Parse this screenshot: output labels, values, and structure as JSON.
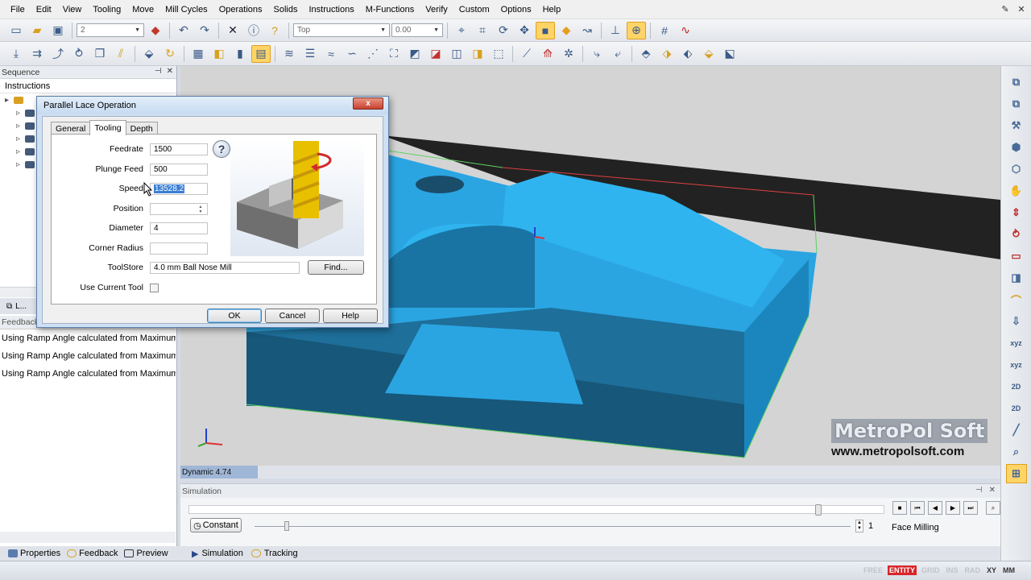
{
  "menu": [
    "File",
    "Edit",
    "View",
    "Tooling",
    "Move",
    "Mill Cycles",
    "Operations",
    "Solids",
    "Instructions",
    "M-Functions",
    "Verify",
    "Custom",
    "Options",
    "Help"
  ],
  "toolbar": {
    "layer_value": "2",
    "view_value": "Top",
    "offset_value": "0.00"
  },
  "sequence_panel": {
    "title": "Sequence",
    "tree_title": "Instructions",
    "tab_label": "L..."
  },
  "feedback_panel": {
    "title": "Feedback",
    "lines": [
      "Using Ramp Angle calculated from Maximum",
      "Using Ramp Angle calculated from Maximum",
      "Using Ramp Angle calculated from Maximum"
    ]
  },
  "left_tabs": [
    "Properties",
    "Feedback",
    "Preview"
  ],
  "dialog": {
    "title": "Parallel Lace Operation",
    "close_label": "x",
    "tabs": [
      "General",
      "Tooling",
      "Depth"
    ],
    "active_tab": "Tooling",
    "fields": {
      "feedrate_label": "Feedrate",
      "feedrate_value": "1500",
      "plunge_label": "Plunge Feed",
      "plunge_value": "500",
      "speed_label": "Speed",
      "speed_value": "13528.2",
      "position_label": "Position",
      "position_value": "",
      "diameter_label": "Diameter",
      "diameter_value": "4",
      "corner_label": "Corner Radius",
      "corner_value": "",
      "toolstore_label": "ToolStore",
      "toolstore_value": "4.0 mm Ball Nose Mill",
      "current_tool_label": "Use Current Tool"
    },
    "help_glyph": "?",
    "find_label": "Find...",
    "ok_label": "OK",
    "cancel_label": "Cancel",
    "help_label": "Help"
  },
  "viewport": {
    "status": "Dynamic 4.74",
    "watermark_logo": "MetroPol Soft",
    "watermark_url": "www.metropolsoft.com"
  },
  "right_toolbar": {
    "labels": [
      "xyz",
      "xyz",
      "2D",
      "2D"
    ]
  },
  "simulation": {
    "title": "Simulation",
    "progress": 0.91,
    "speed_position": 0.05,
    "constant_label": "Constant",
    "step_value": "1",
    "operation_label": "Face Milling"
  },
  "sim_tabs": [
    "Simulation",
    "Tracking"
  ],
  "status_flags": {
    "items": [
      "FREE",
      "ENTITY",
      "GRID",
      "INS",
      "RAD",
      "XY",
      "MM"
    ],
    "active": "ENTITY"
  },
  "colors": {
    "part": "#29a9e6",
    "part_dark": "#1c78a6",
    "accent": "#3b7fd4",
    "active_flag": "#d8262a"
  }
}
